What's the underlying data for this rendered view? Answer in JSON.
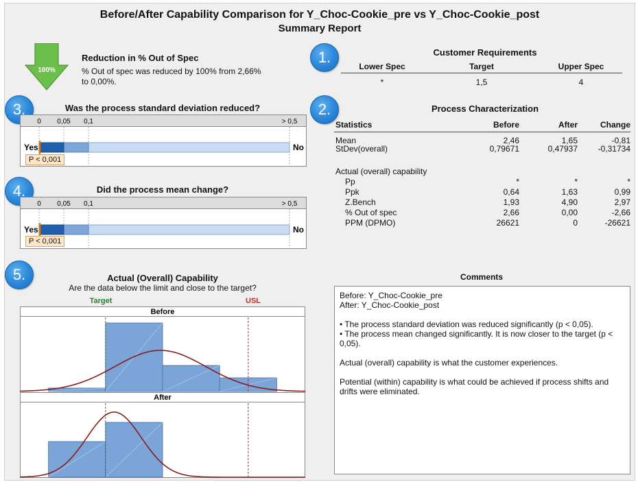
{
  "header": {
    "title": "Before/After Capability Comparison for Y_Choc-Cookie_pre vs Y_Choc-Cookie_post",
    "subtitle": "Summary Report"
  },
  "reduction": {
    "arrow_label": "100%",
    "title": "Reduction in % Out of Spec",
    "text_line1": "% Out of spec was reduced by 100% from 2,66%",
    "text_line2": "to 0,00%."
  },
  "badges": [
    "1.",
    "2.",
    "3.",
    "4.",
    "5."
  ],
  "requirements": {
    "title": "Customer Requirements",
    "headers": [
      "Lower Spec",
      "Target",
      "Upper Spec"
    ],
    "values": [
      "*",
      "1,5",
      "4"
    ]
  },
  "process": {
    "title": "Process Characterization",
    "headers": [
      "Statistics",
      "Before",
      "After",
      "Change"
    ],
    "rows": [
      [
        "Mean",
        "2,46",
        "1,65",
        "-0,81"
      ],
      [
        "StDev(overall)",
        "0,79671",
        "0,47937",
        "-0,31734"
      ]
    ],
    "capability_label": "Actual (overall) capability",
    "cap_rows": [
      [
        "Pp",
        "*",
        "*",
        "*"
      ],
      [
        "Ppk",
        "0,64",
        "1,63",
        "0,99"
      ],
      [
        "Z.Bench",
        "1,93",
        "4,90",
        "2,97"
      ],
      [
        "% Out of spec",
        "2,66",
        "0,00",
        "-2,66"
      ],
      [
        "PPM (DPMO)",
        "26621",
        "0",
        "-26621"
      ]
    ]
  },
  "stdev_test": {
    "title": "Was the process standard deviation reduced?",
    "ticks": [
      "0",
      "0,05",
      "0,1",
      "> 0,5"
    ],
    "yes": "Yes",
    "no": "No",
    "p_value": "P < 0,001"
  },
  "mean_test": {
    "title": "Did the process mean change?",
    "ticks": [
      "0",
      "0,05",
      "0,1",
      "> 0,5"
    ],
    "yes": "Yes",
    "no": "No",
    "p_value": "P < 0,001"
  },
  "capability": {
    "title": "Actual (Overall) Capability",
    "subtitle": "Are the data below the limit and close to the target?",
    "target_label": "Target",
    "usl_label": "USL",
    "before_label": "Before",
    "after_label": "After"
  },
  "comments": {
    "title": "Comments",
    "lines": [
      "Before: Y_Choc-Cookie_pre",
      "After: Y_Choc-Cookie_post",
      "",
      "• The process standard deviation was reduced significantly (p < 0,05).",
      "• The process mean changed significantly. It is now closer to the target (p <",
      "0,05).",
      "",
      "Actual (overall) capability is what the customer experiences.",
      "",
      "Potential (within) capability is what could be achieved if process shifts and",
      "drifts were eliminated."
    ]
  },
  "chart_data": [
    {
      "type": "bar",
      "title": "Was the process standard deviation reduced?",
      "xlim": [
        0,
        0.5
      ],
      "ticks": [
        "0",
        "0,05",
        "0,1",
        "> 0,5"
      ],
      "p_value": "P < 0,001"
    },
    {
      "type": "bar",
      "title": "Did the process mean change?",
      "xlim": [
        0,
        0.5
      ],
      "ticks": [
        "0",
        "0,05",
        "0,1",
        "> 0,5"
      ],
      "p_value": "P < 0,001"
    },
    {
      "type": "bar",
      "title": "Actual (Overall) Capability",
      "subtitle": "Are the data below the limit and close to the target?",
      "target": 1.5,
      "usl": 4,
      "xlim": [
        0.0,
        5.0
      ],
      "series": [
        {
          "name": "Before",
          "bin_edges": [
            0.5,
            1.5,
            2.5,
            3.5,
            4.5
          ],
          "heights": [
            0.05,
            1.0,
            0.38,
            0.2
          ],
          "mean": 2.46,
          "stdev": 0.79671
        },
        {
          "name": "After",
          "bin_edges": [
            0.5,
            1.5,
            2.5
          ],
          "heights": [
            0.52,
            0.8
          ],
          "mean": 1.65,
          "stdev": 0.47937
        }
      ]
    }
  ],
  "colors": {
    "badge": "#2a86d8",
    "arrow": "#6cbf4a",
    "bar_dark": "#1f5fad",
    "bar_mid": "#7ea6d8",
    "bar_light": "#c9dbf2",
    "hist_fill": "#7ba5d9",
    "curve": "#8b1a1a",
    "target_line": "#2e7d32",
    "usl_line": "#c62828"
  }
}
